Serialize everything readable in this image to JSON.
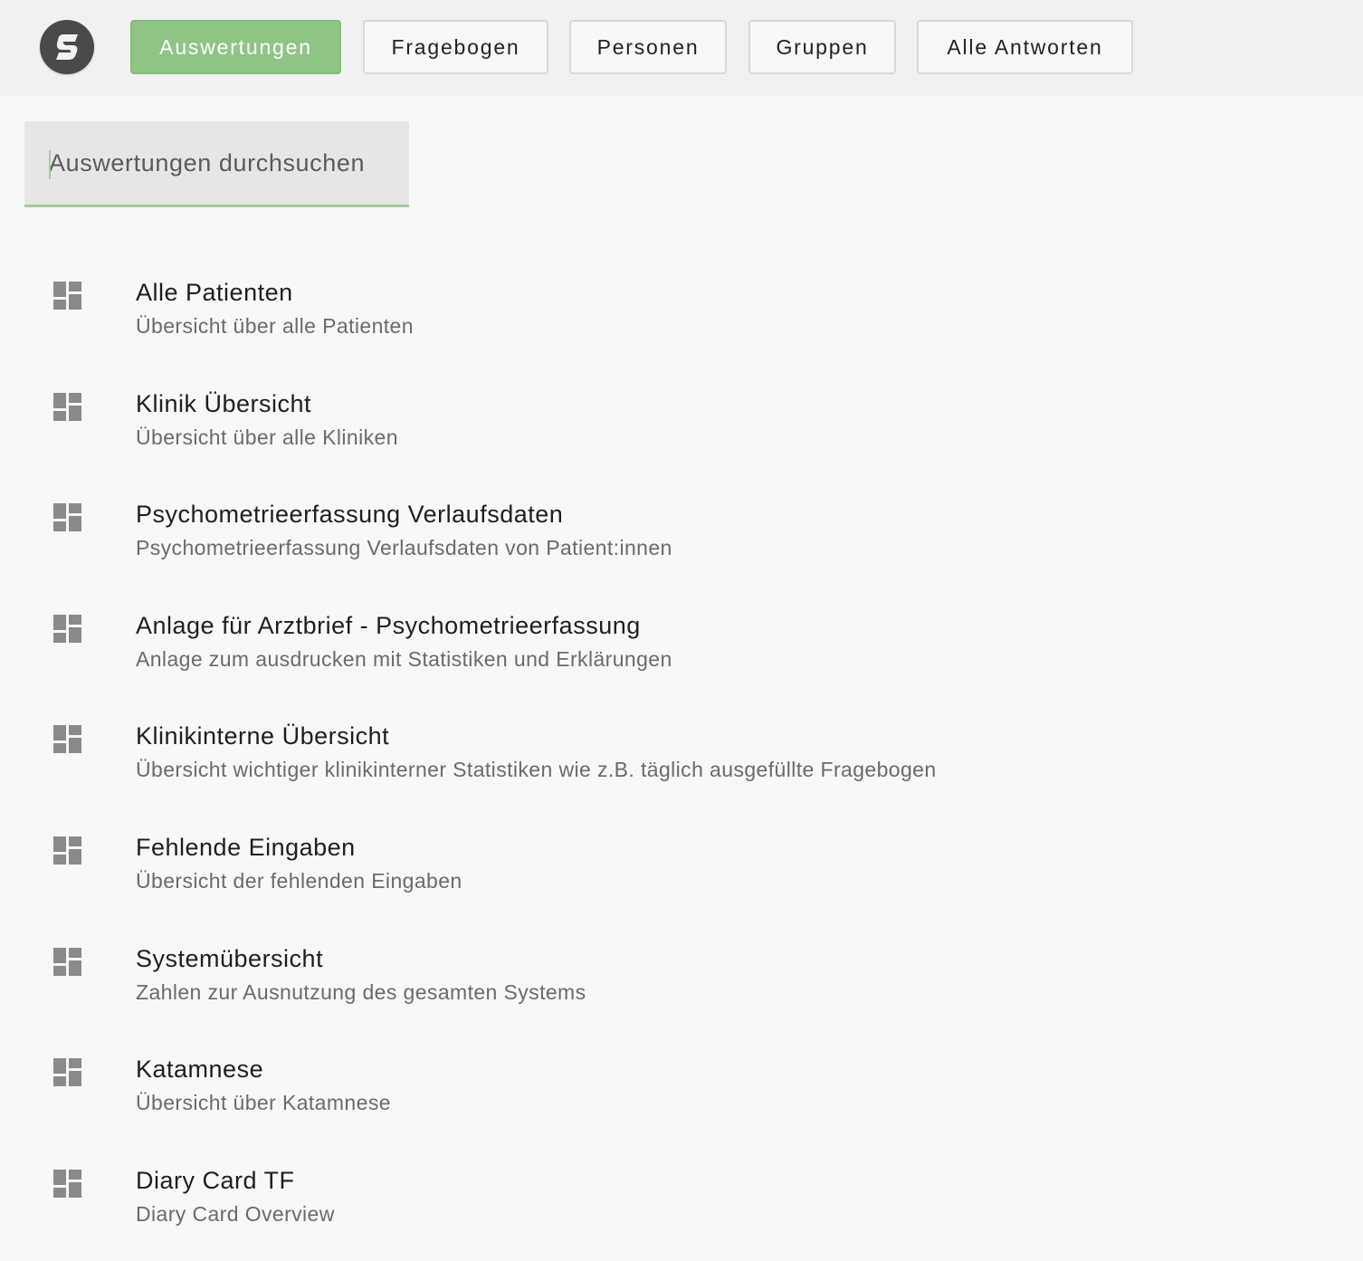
{
  "header": {
    "logo_icon": "s-logo-icon",
    "nav": [
      {
        "label": "Auswertungen",
        "active": true
      },
      {
        "label": "Fragebogen",
        "active": false
      },
      {
        "label": "Personen",
        "active": false
      },
      {
        "label": "Gruppen",
        "active": false
      },
      {
        "label": "Alle Antworten",
        "active": false
      }
    ]
  },
  "search": {
    "placeholder": "Auswertungen durchsuchen",
    "value": ""
  },
  "items": [
    {
      "title": "Alle Patienten",
      "subtitle": "Übersicht über alle Patienten",
      "icon": "dashboard-icon"
    },
    {
      "title": "Klinik Übersicht",
      "subtitle": "Übersicht über alle Kliniken",
      "icon": "dashboard-icon"
    },
    {
      "title": "Psychometrieerfassung Verlaufsdaten",
      "subtitle": "Psychometrieerfassung Verlaufsdaten von Patient:innen",
      "icon": "dashboard-icon"
    },
    {
      "title": "Anlage für Arztbrief - Psychometrieerfassung",
      "subtitle": "Anlage zum ausdrucken mit Statistiken und Erklärungen",
      "icon": "dashboard-icon"
    },
    {
      "title": "Klinikinterne Übersicht",
      "subtitle": "Übersicht wichtiger klinikinterner Statistiken wie z.B. täglich ausgefüllte Fragebogen",
      "icon": "dashboard-icon"
    },
    {
      "title": "Fehlende Eingaben",
      "subtitle": "Übersicht der fehlenden Eingaben",
      "icon": "dashboard-icon"
    },
    {
      "title": "Systemübersicht",
      "subtitle": "Zahlen zur Ausnutzung des gesamten Systems",
      "icon": "dashboard-icon"
    },
    {
      "title": "Katamnese",
      "subtitle": "Übersicht über Katamnese",
      "icon": "dashboard-icon"
    },
    {
      "title": "Diary Card TF",
      "subtitle": "Diary Card Overview",
      "icon": "dashboard-icon"
    }
  ],
  "colors": {
    "accent": "#8ec585",
    "background": "#f8f8f8",
    "header_background": "#f1f1f1",
    "icon": "#8a8a8a"
  }
}
